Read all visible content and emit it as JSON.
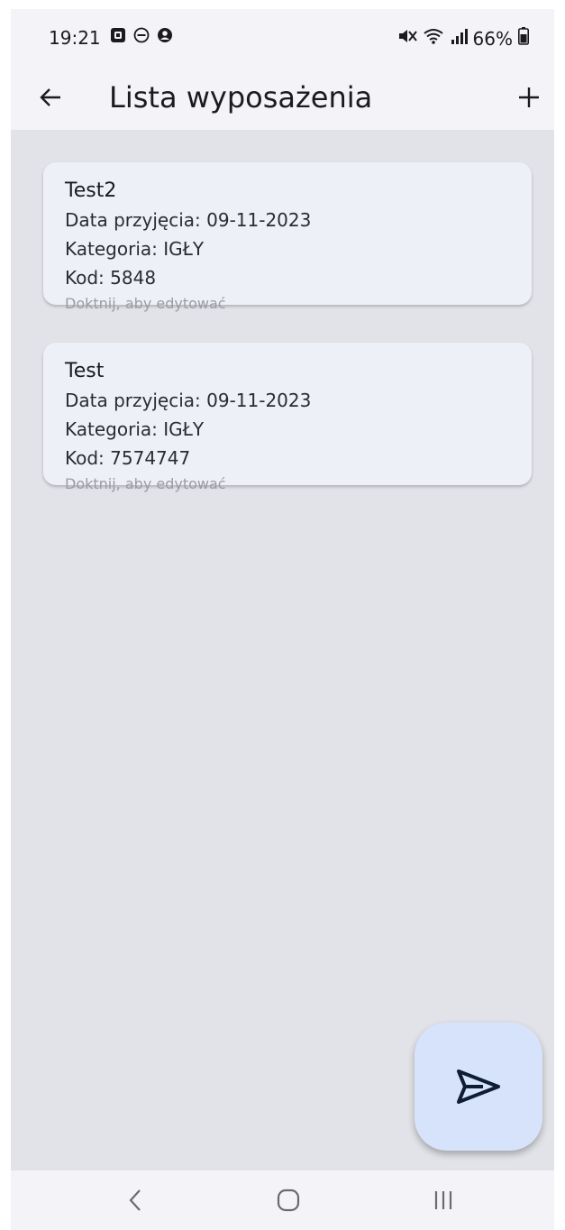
{
  "status_bar": {
    "time": "19:21",
    "left_icons": [
      "notification-app-icon",
      "do-not-disturb-icon",
      "account-icon"
    ],
    "right_icons": [
      "mute-icon",
      "wifi-icon",
      "signal-icon"
    ],
    "battery": "66%"
  },
  "app_bar": {
    "title": "Lista wyposażenia",
    "back_icon": "arrow-back-icon",
    "add_icon": "plus-icon"
  },
  "items": [
    {
      "name": "Test2",
      "date": "Data przyjęcia: 09-11-2023",
      "category": "Kategoria: IGŁY",
      "code": "Kod: 5848",
      "hint": "Doktnij, aby edytować"
    },
    {
      "name": "Test",
      "date": "Data przyjęcia: 09-11-2023",
      "category": "Kategoria: IGŁY",
      "code": "Kod: 7574747",
      "hint": "Doktnij, aby edytować"
    }
  ],
  "fab": {
    "icon": "send-icon"
  },
  "nav_bar": {
    "icons": [
      "nav-back-icon",
      "nav-home-icon",
      "nav-recents-icon"
    ]
  },
  "colors": {
    "background": "#e2e3e8",
    "bar": "#f3f3f8",
    "card": "#eef0f8",
    "fab": "#d6e3fb",
    "text": "#1b1b1f",
    "hint": "#9a9ca3"
  }
}
